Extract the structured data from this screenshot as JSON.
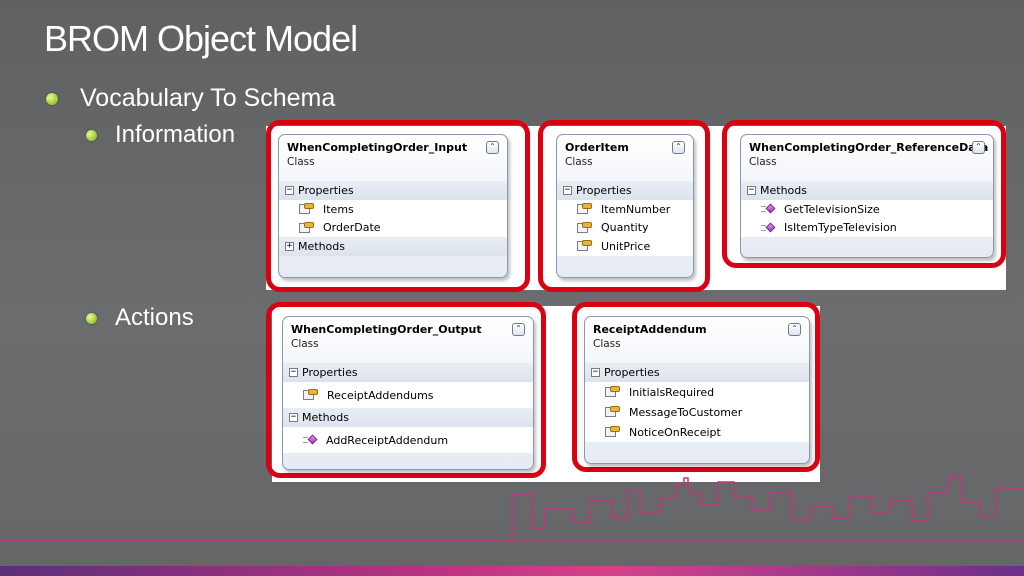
{
  "slide": {
    "title": "BROM Object Model",
    "bullets": {
      "main": "Vocabulary To Schema",
      "information": "Information",
      "actions": "Actions"
    }
  },
  "diagram": {
    "card_type_label": "Class",
    "collapse_glyph": "⌃",
    "cards": {
      "input": {
        "name": "WhenCompletingOrder_Input",
        "properties_label": "Properties",
        "properties": [
          "Items",
          "OrderDate"
        ],
        "methods_label": "Methods"
      },
      "order_item": {
        "name": "OrderItem",
        "properties_label": "Properties",
        "properties": [
          "ItemNumber",
          "Quantity",
          "UnitPrice"
        ]
      },
      "reference_data": {
        "name": "WhenCompletingOrder_ReferenceData",
        "methods_label": "Methods",
        "methods": [
          "GetTelevisionSize",
          "IsItemTypeTelevision"
        ]
      },
      "output": {
        "name": "WhenCompletingOrder_Output",
        "properties_label": "Properties",
        "properties": [
          "ReceiptAddendums"
        ],
        "methods_label": "Methods",
        "methods": [
          "AddReceiptAddendum"
        ]
      },
      "receipt_addendum": {
        "name": "ReceiptAddendum",
        "properties_label": "Properties",
        "properties": [
          "InitialsRequired",
          "MessageToCustomer",
          "NoticeOnReceipt"
        ]
      }
    }
  },
  "colors": {
    "highlight": "#d90012",
    "bullet": "#b3dc4b",
    "skyline": "#c0347f",
    "background": "#636567"
  },
  "icons": {
    "property": "property-icon",
    "method": "method-icon",
    "bullet": "bullet-dot-icon",
    "collapse": "collapse-chevron-icon"
  }
}
